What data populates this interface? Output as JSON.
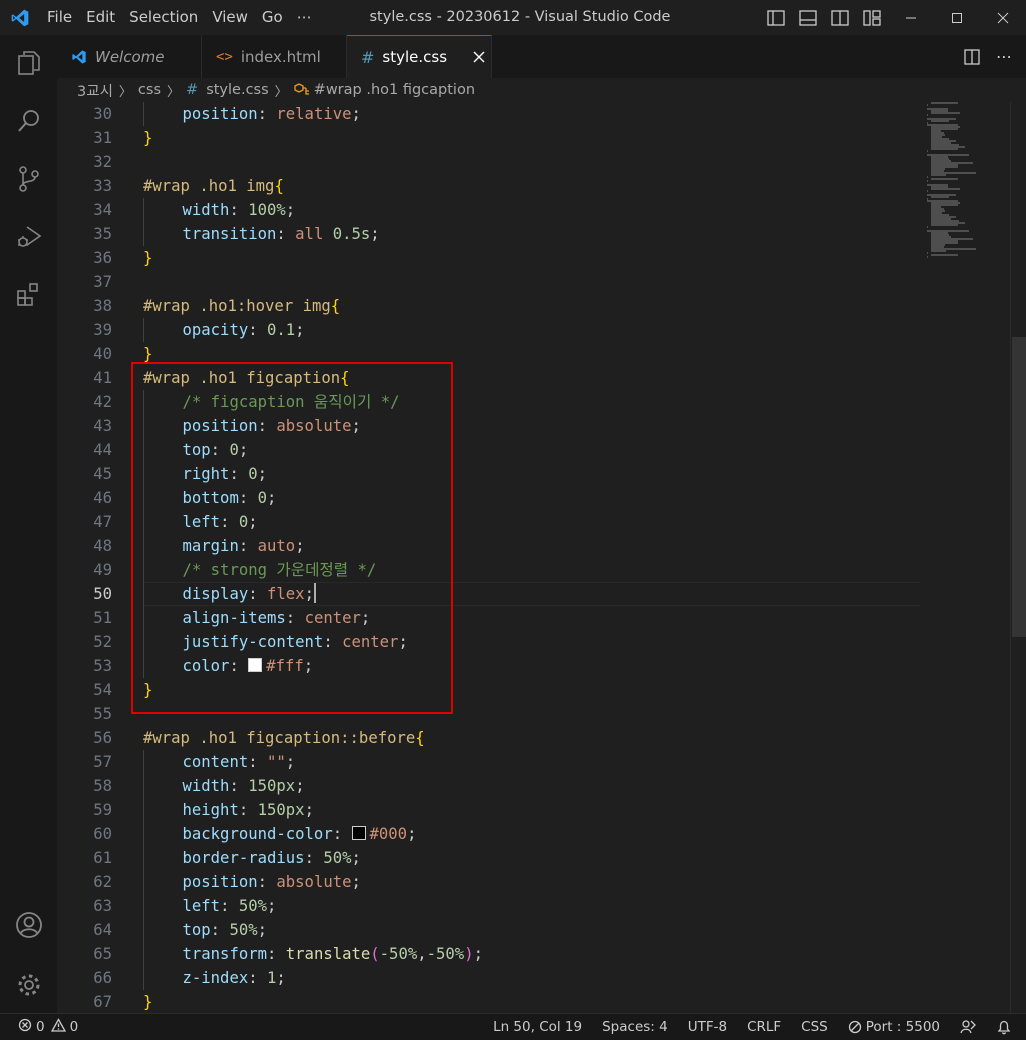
{
  "window": {
    "title": "style.css - 20230612 - Visual Studio Code"
  },
  "menu": [
    "File",
    "Edit",
    "Selection",
    "View",
    "Go",
    "⋯"
  ],
  "tabs": [
    {
      "label": "Welcome",
      "icon": "vscode-logo-icon"
    },
    {
      "label": "index.html",
      "icon": "html-file-icon"
    },
    {
      "label": "style.css",
      "icon": "css-file-icon",
      "active": true
    }
  ],
  "breadcrumb": [
    "3교시",
    "css",
    "style.css",
    "#wrap .ho1 figcaption"
  ],
  "editor": {
    "current_line": "50",
    "lines": [
      {
        "n": "30",
        "indent": 1,
        "tokens": [
          [
            "prop",
            "position"
          ],
          [
            "pun",
            ": "
          ],
          [
            "val",
            "relative"
          ],
          [
            "pun",
            ";"
          ]
        ]
      },
      {
        "n": "31",
        "indent": 0,
        "tokens": [
          [
            "br",
            "}"
          ]
        ]
      },
      {
        "n": "32",
        "indent": 0,
        "tokens": []
      },
      {
        "n": "33",
        "indent": 0,
        "tokens": [
          [
            "sel",
            "#wrap .ho1 img"
          ],
          [
            "br",
            "{"
          ]
        ]
      },
      {
        "n": "34",
        "indent": 1,
        "tokens": [
          [
            "prop",
            "width"
          ],
          [
            "pun",
            ": "
          ],
          [
            "num",
            "100%"
          ],
          [
            "pun",
            ";"
          ]
        ]
      },
      {
        "n": "35",
        "indent": 1,
        "tokens": [
          [
            "prop",
            "transition"
          ],
          [
            "pun",
            ": "
          ],
          [
            "val",
            "all "
          ],
          [
            "num",
            "0.5s"
          ],
          [
            "pun",
            ";"
          ]
        ]
      },
      {
        "n": "36",
        "indent": 0,
        "tokens": [
          [
            "br",
            "}"
          ]
        ]
      },
      {
        "n": "37",
        "indent": 0,
        "tokens": []
      },
      {
        "n": "38",
        "indent": 0,
        "tokens": [
          [
            "sel",
            "#wrap .ho1:hover img"
          ],
          [
            "br",
            "{"
          ]
        ]
      },
      {
        "n": "39",
        "indent": 1,
        "tokens": [
          [
            "prop",
            "opacity"
          ],
          [
            "pun",
            ": "
          ],
          [
            "num",
            "0.1"
          ],
          [
            "pun",
            ";"
          ]
        ]
      },
      {
        "n": "40",
        "indent": 0,
        "tokens": [
          [
            "br",
            "}"
          ]
        ]
      },
      {
        "n": "41",
        "indent": 0,
        "tokens": [
          [
            "sel",
            "#wrap .ho1 figcaption"
          ],
          [
            "br",
            "{"
          ]
        ]
      },
      {
        "n": "42",
        "indent": 1,
        "tokens": [
          [
            "cm",
            "/* figcaption 움직이기 */"
          ]
        ]
      },
      {
        "n": "43",
        "indent": 1,
        "tokens": [
          [
            "prop",
            "position"
          ],
          [
            "pun",
            ": "
          ],
          [
            "val",
            "absolute"
          ],
          [
            "pun",
            ";"
          ]
        ]
      },
      {
        "n": "44",
        "indent": 1,
        "tokens": [
          [
            "prop",
            "top"
          ],
          [
            "pun",
            ": "
          ],
          [
            "num",
            "0"
          ],
          [
            "pun",
            ";"
          ]
        ]
      },
      {
        "n": "45",
        "indent": 1,
        "tokens": [
          [
            "prop",
            "right"
          ],
          [
            "pun",
            ": "
          ],
          [
            "num",
            "0"
          ],
          [
            "pun",
            ";"
          ]
        ]
      },
      {
        "n": "46",
        "indent": 1,
        "tokens": [
          [
            "prop",
            "bottom"
          ],
          [
            "pun",
            ": "
          ],
          [
            "num",
            "0"
          ],
          [
            "pun",
            ";"
          ]
        ]
      },
      {
        "n": "47",
        "indent": 1,
        "tokens": [
          [
            "prop",
            "left"
          ],
          [
            "pun",
            ": "
          ],
          [
            "num",
            "0"
          ],
          [
            "pun",
            ";"
          ]
        ]
      },
      {
        "n": "48",
        "indent": 1,
        "tokens": [
          [
            "prop",
            "margin"
          ],
          [
            "pun",
            ": "
          ],
          [
            "val",
            "auto"
          ],
          [
            "pun",
            ";"
          ]
        ]
      },
      {
        "n": "49",
        "indent": 1,
        "tokens": [
          [
            "cm",
            "/* strong 가운데정렬 */"
          ]
        ]
      },
      {
        "n": "50",
        "indent": 1,
        "tokens": [
          [
            "prop",
            "display"
          ],
          [
            "pun",
            ": "
          ],
          [
            "val",
            "flex"
          ],
          [
            "pun",
            ";"
          ],
          [
            "cursor",
            ""
          ]
        ]
      },
      {
        "n": "51",
        "indent": 1,
        "tokens": [
          [
            "prop",
            "align-items"
          ],
          [
            "pun",
            ": "
          ],
          [
            "val",
            "center"
          ],
          [
            "pun",
            ";"
          ]
        ]
      },
      {
        "n": "52",
        "indent": 1,
        "tokens": [
          [
            "prop",
            "justify-content"
          ],
          [
            "pun",
            ": "
          ],
          [
            "val",
            "center"
          ],
          [
            "pun",
            ";"
          ]
        ]
      },
      {
        "n": "53",
        "indent": 1,
        "tokens": [
          [
            "prop",
            "color"
          ],
          [
            "pun",
            ": "
          ],
          [
            "swatch",
            "#ffffff"
          ],
          [
            "val",
            "#fff"
          ],
          [
            "pun",
            ";"
          ]
        ]
      },
      {
        "n": "54",
        "indent": 0,
        "tokens": [
          [
            "br",
            "}"
          ]
        ]
      },
      {
        "n": "55",
        "indent": 0,
        "tokens": []
      },
      {
        "n": "56",
        "indent": 0,
        "tokens": [
          [
            "sel",
            "#wrap .ho1 figcaption::before"
          ],
          [
            "br",
            "{"
          ]
        ]
      },
      {
        "n": "57",
        "indent": 1,
        "tokens": [
          [
            "prop",
            "content"
          ],
          [
            "pun",
            ": "
          ],
          [
            "val",
            "\"\""
          ],
          [
            "pun",
            ";"
          ]
        ]
      },
      {
        "n": "58",
        "indent": 1,
        "tokens": [
          [
            "prop",
            "width"
          ],
          [
            "pun",
            ": "
          ],
          [
            "num",
            "150px"
          ],
          [
            "pun",
            ";"
          ]
        ]
      },
      {
        "n": "59",
        "indent": 1,
        "tokens": [
          [
            "prop",
            "height"
          ],
          [
            "pun",
            ": "
          ],
          [
            "num",
            "150px"
          ],
          [
            "pun",
            ";"
          ]
        ]
      },
      {
        "n": "60",
        "indent": 1,
        "tokens": [
          [
            "prop",
            "background-color"
          ],
          [
            "pun",
            ": "
          ],
          [
            "swatch",
            "#000000"
          ],
          [
            "val",
            "#000"
          ],
          [
            "pun",
            ";"
          ]
        ]
      },
      {
        "n": "61",
        "indent": 1,
        "tokens": [
          [
            "prop",
            "border-radius"
          ],
          [
            "pun",
            ": "
          ],
          [
            "num",
            "50%"
          ],
          [
            "pun",
            ";"
          ]
        ]
      },
      {
        "n": "62",
        "indent": 1,
        "tokens": [
          [
            "prop",
            "position"
          ],
          [
            "pun",
            ": "
          ],
          [
            "val",
            "absolute"
          ],
          [
            "pun",
            ";"
          ]
        ]
      },
      {
        "n": "63",
        "indent": 1,
        "tokens": [
          [
            "prop",
            "left"
          ],
          [
            "pun",
            ": "
          ],
          [
            "num",
            "50%"
          ],
          [
            "pun",
            ";"
          ]
        ]
      },
      {
        "n": "64",
        "indent": 1,
        "tokens": [
          [
            "prop",
            "top"
          ],
          [
            "pun",
            ": "
          ],
          [
            "num",
            "50%"
          ],
          [
            "pun",
            ";"
          ]
        ]
      },
      {
        "n": "65",
        "indent": 1,
        "tokens": [
          [
            "prop",
            "transform"
          ],
          [
            "pun",
            ": "
          ],
          [
            "fn",
            "translate"
          ],
          [
            "br2",
            "("
          ],
          [
            "num",
            "-50%"
          ],
          [
            "pun",
            ","
          ],
          [
            "num",
            "-50%"
          ],
          [
            "br2",
            ")"
          ],
          [
            "pun",
            ";"
          ]
        ]
      },
      {
        "n": "66",
        "indent": 1,
        "tokens": [
          [
            "prop",
            "z-index"
          ],
          [
            "pun",
            ": "
          ],
          [
            "num",
            "1"
          ],
          [
            "pun",
            ";"
          ]
        ]
      },
      {
        "n": "67",
        "indent": 0,
        "tokens": [
          [
            "br",
            "}"
          ]
        ]
      }
    ]
  },
  "status": {
    "errors": "0",
    "warnings": "0",
    "position": "Ln 50, Col 19",
    "spaces": "Spaces: 4",
    "encoding": "UTF-8",
    "eol": "CRLF",
    "language": "CSS",
    "port": "Port : 5500"
  },
  "colors": {
    "accent": "#0078d4",
    "highlight_box": "#e00000"
  }
}
